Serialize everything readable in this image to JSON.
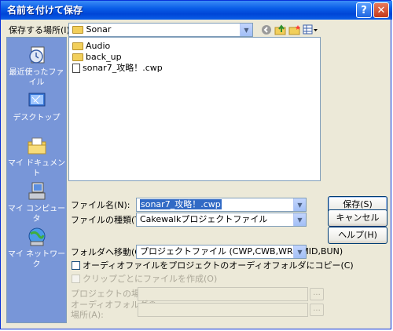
{
  "window": {
    "title": "名前を付けて保存",
    "help_button": "?",
    "close_button": "✕"
  },
  "location": {
    "label": "保存する場所(I):",
    "value": "Sonar"
  },
  "toolbar": {
    "back_icon": "back-icon",
    "up_icon": "up-folder-icon",
    "new_folder_icon": "new-folder-icon",
    "views_icon": "views-menu-icon"
  },
  "places": [
    {
      "label": "最近使ったファイル",
      "icon": "recent-documents-icon"
    },
    {
      "label": "デスクトップ",
      "icon": "desktop-icon"
    },
    {
      "label": "マイ ドキュメント",
      "icon": "my-documents-icon"
    },
    {
      "label": "マイ コンピュータ",
      "icon": "my-computer-icon"
    },
    {
      "label": "マイ ネットワーク",
      "icon": "my-network-icon"
    }
  ],
  "files": [
    {
      "name": "Audio",
      "type": "folder"
    },
    {
      "name": "back_up",
      "type": "folder"
    },
    {
      "name": "sonar7_攻略！.cwp",
      "type": "file"
    }
  ],
  "filename": {
    "label": "ファイル名(N):",
    "value": "sonar7_攻略！.cwp"
  },
  "filetype": {
    "label": "ファイルの種類(T):",
    "value": "Cakewalkプロジェクトファイル"
  },
  "goto_folder": {
    "label": "フォルダへ移動(G):",
    "value": "プロジェクトファイル (CWP,CWB,WRK,MID,BUN)"
  },
  "buttons": {
    "save": "保存(S)",
    "cancel": "キャンセル",
    "help": "ヘルプ(H)"
  },
  "options": {
    "copy_audio": "オーディオファイルをプロジェクトのオーディオフォルダにコピー(C)",
    "per_clip": "クリップごとにファイルを作成(O)",
    "project_location_label": "プロジェクトの場所(E):",
    "audio_folder_label_1": "オーディオフォルダの",
    "audio_folder_label_2": "場所(A):",
    "browse": "..."
  },
  "colors": {
    "title_bar": "#0a5ee8",
    "places_bar": "#7896d8",
    "dialog_bg": "#ece9d8",
    "selection": "#316ac5"
  }
}
